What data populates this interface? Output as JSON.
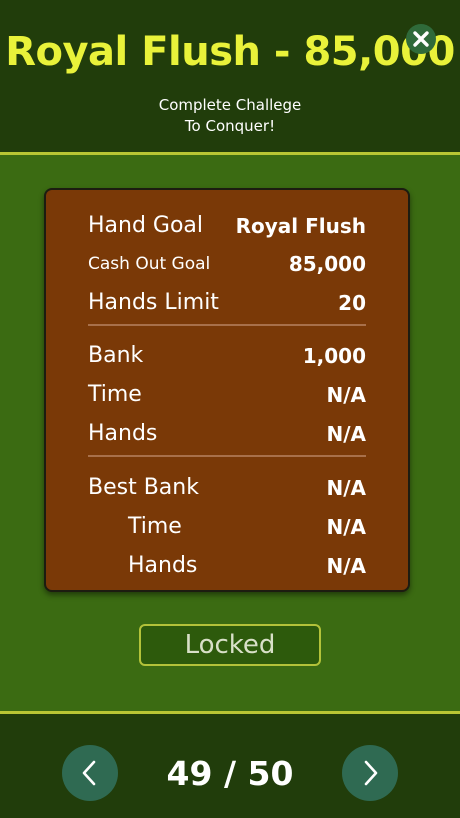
{
  "header": {
    "title": "Royal Flush - 85,000",
    "subtitle_line1": "Complete Challege",
    "subtitle_line2": "To Conquer!",
    "close_icon": "close-icon"
  },
  "stats": {
    "hand_goal": {
      "label": "Hand Goal",
      "value": "Royal Flush"
    },
    "cash_out_goal": {
      "label": "Cash Out Goal",
      "value": "85,000"
    },
    "hands_limit": {
      "label": "Hands Limit",
      "value": "20"
    },
    "bank": {
      "label": "Bank",
      "value": "1,000"
    },
    "time": {
      "label": "Time",
      "value": "N/A"
    },
    "hands": {
      "label": "Hands",
      "value": "N/A"
    },
    "best_bank": {
      "label": "Best Bank",
      "value": "N/A"
    },
    "best_time": {
      "label": "Time",
      "value": "N/A"
    },
    "best_hands": {
      "label": "Hands",
      "value": "N/A"
    }
  },
  "status_button": {
    "label": "Locked"
  },
  "pager": {
    "label": "49 / 50",
    "prev_icon": "chevron-left-icon",
    "next_icon": "chevron-right-icon"
  },
  "colors": {
    "title": "#e9f23a",
    "header_bg": "#213d0b",
    "main_bg": "#3b6b12",
    "card_bg": "#7a3907",
    "accent_line": "#b9c634",
    "nav_button": "#2f6a52"
  }
}
